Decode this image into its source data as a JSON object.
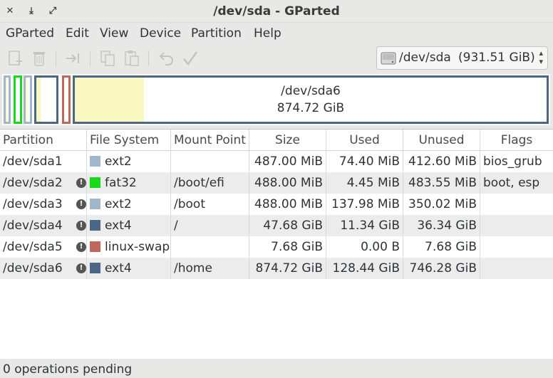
{
  "window": {
    "title": "/dev/sda - GParted",
    "close_glyph": "✕",
    "minimize_glyph": "⤓",
    "maximize_glyph": "⤢"
  },
  "menu": [
    "GParted",
    "Edit",
    "View",
    "Device",
    "Partition",
    "Help"
  ],
  "toolbar": {
    "icons": [
      "new-icon",
      "delete-icon",
      "resize-move-icon",
      "copy-icon",
      "paste-icon",
      "undo-icon",
      "apply-icon"
    ]
  },
  "device": {
    "name": "/dev/sda",
    "size": "(931.51 GiB)",
    "arrow_up": "▴",
    "arrow_down": "▾"
  },
  "diskmap": {
    "selected_name": "/dev/sda6",
    "selected_size": "874.72 GiB"
  },
  "table": {
    "headers": [
      "Partition",
      "File System",
      "Mount Point",
      "Size",
      "Used",
      "Unused",
      "Flags"
    ],
    "rows": [
      {
        "partition": "/dev/sda1",
        "locked": false,
        "fs": "ext2",
        "fs_color": "#9fb6cd",
        "mount": "",
        "size": "487.00 MiB",
        "used": "74.40 MiB",
        "unused": "412.60 MiB",
        "flags": "bios_grub"
      },
      {
        "partition": "/dev/sda2",
        "locked": true,
        "fs": "fat32",
        "fs_color": "#18d918",
        "mount": "/boot/efi",
        "size": "488.00 MiB",
        "used": "4.45 MiB",
        "unused": "483.55 MiB",
        "flags": "boot, esp"
      },
      {
        "partition": "/dev/sda3",
        "locked": true,
        "fs": "ext2",
        "fs_color": "#9fb6cd",
        "mount": "/boot",
        "size": "488.00 MiB",
        "used": "137.98 MiB",
        "unused": "350.02 MiB",
        "flags": ""
      },
      {
        "partition": "/dev/sda4",
        "locked": true,
        "fs": "ext4",
        "fs_color": "#4a6785",
        "mount": "/",
        "size": "47.68 GiB",
        "used": "11.34 GiB",
        "unused": "36.34 GiB",
        "flags": ""
      },
      {
        "partition": "/dev/sda5",
        "locked": true,
        "fs": "linux-swap",
        "fs_color": "#c1665a",
        "mount": "",
        "size": "7.68 GiB",
        "used": "0.00 B",
        "unused": "7.68 GiB",
        "flags": ""
      },
      {
        "partition": "/dev/sda6",
        "locked": true,
        "fs": "ext4",
        "fs_color": "#4a6785",
        "mount": "/home",
        "size": "874.72 GiB",
        "used": "128.44 GiB",
        "unused": "746.28 GiB",
        "flags": ""
      }
    ],
    "lock_glyph": "!"
  },
  "status": {
    "text": "0 operations pending"
  },
  "colors": {
    "ext2": "#9fb6cd",
    "fat32": "#18d918",
    "ext4": "#4a6785",
    "linux_swap": "#c1665a",
    "used_fill": "#f8f8c0"
  }
}
